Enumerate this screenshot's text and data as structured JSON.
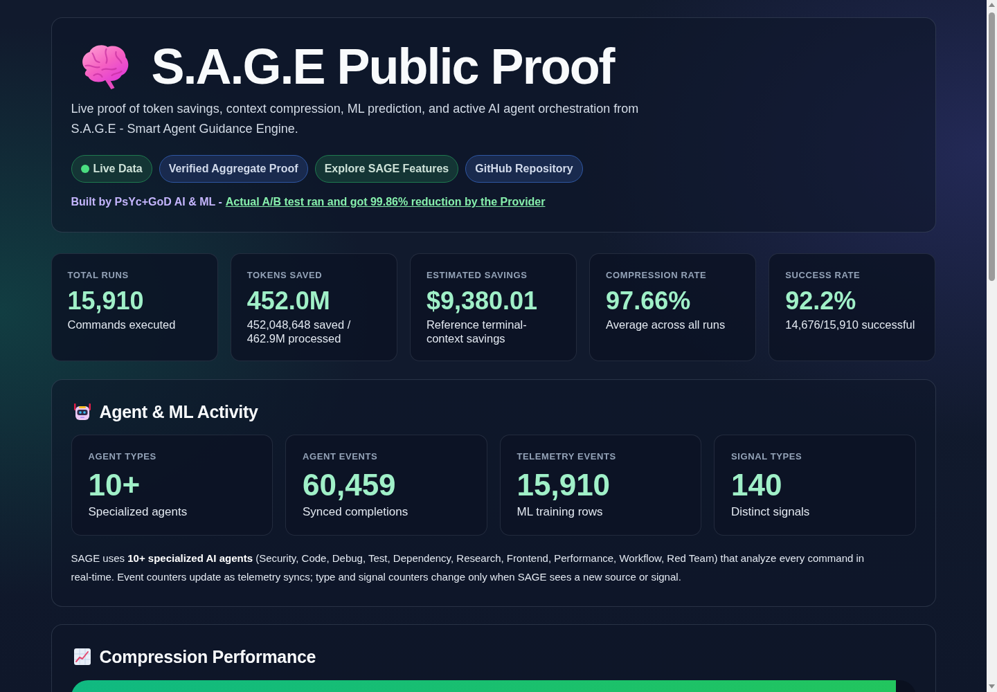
{
  "header": {
    "title": "S.A.G.E Public Proof",
    "description": "Live proof of token savings, context compression, ML prediction, and active AI agent orchestration from S.A.G.E - Smart Agent Guidance Engine.",
    "badges": [
      {
        "kind": "status",
        "label": "Live Data",
        "color": "#1f7a4f"
      },
      {
        "kind": "link",
        "label": "Verified Aggregate Proof",
        "color": "#2f57a3"
      },
      {
        "kind": "link",
        "label": "Explore SAGE Features",
        "color": "#1f7a4f"
      },
      {
        "kind": "link",
        "label": "GitHub Repository",
        "color": "#2f57a3"
      }
    ],
    "credit": {
      "text": "Built by PsYc+GoD AI & ML -",
      "link": "Actual A/B test ran and got 99.86% reduction by the Provider"
    }
  },
  "stats": [
    {
      "label": "TOTAL RUNS",
      "value": "15,910",
      "detail": "Commands executed"
    },
    {
      "label": "TOKENS SAVED",
      "value": "452.0M",
      "detail": "452,048,648 saved / 462.9M processed"
    },
    {
      "label": "ESTIMATED SAVINGS",
      "value": "$9,380.01",
      "detail": "Reference terminal-context savings"
    },
    {
      "label": "COMPRESSION RATE",
      "value": "97.66%",
      "detail": "Average across all runs"
    },
    {
      "label": "SUCCESS RATE",
      "value": "92.2%",
      "detail": "14,676/15,910 successful"
    }
  ],
  "agent_activity": {
    "title": "Agent & ML Activity",
    "metrics": [
      {
        "label": "AGENT TYPES",
        "value": "10+",
        "detail": "Specialized agents"
      },
      {
        "label": "AGENT EVENTS",
        "value": "60,459",
        "detail": "Synced completions"
      },
      {
        "label": "TELEMETRY EVENTS",
        "value": "15,910",
        "detail": "ML training rows"
      },
      {
        "label": "SIGNAL TYPES",
        "value": "140",
        "detail": "Distinct signals"
      }
    ],
    "note": "SAGE uses **10+ specialized AI agents** (Security, Code, Debug, Test, Dependency, Research, Frontend, Performance, Workflow, Red Team) that analyze every command in real-time. Event counters update as telemetry syncs; type and signal counters change only when SAGE sees a new source or signal."
  },
  "compression_performance": {
    "title": "Compression Performance",
    "level": 0.9766
  }
}
